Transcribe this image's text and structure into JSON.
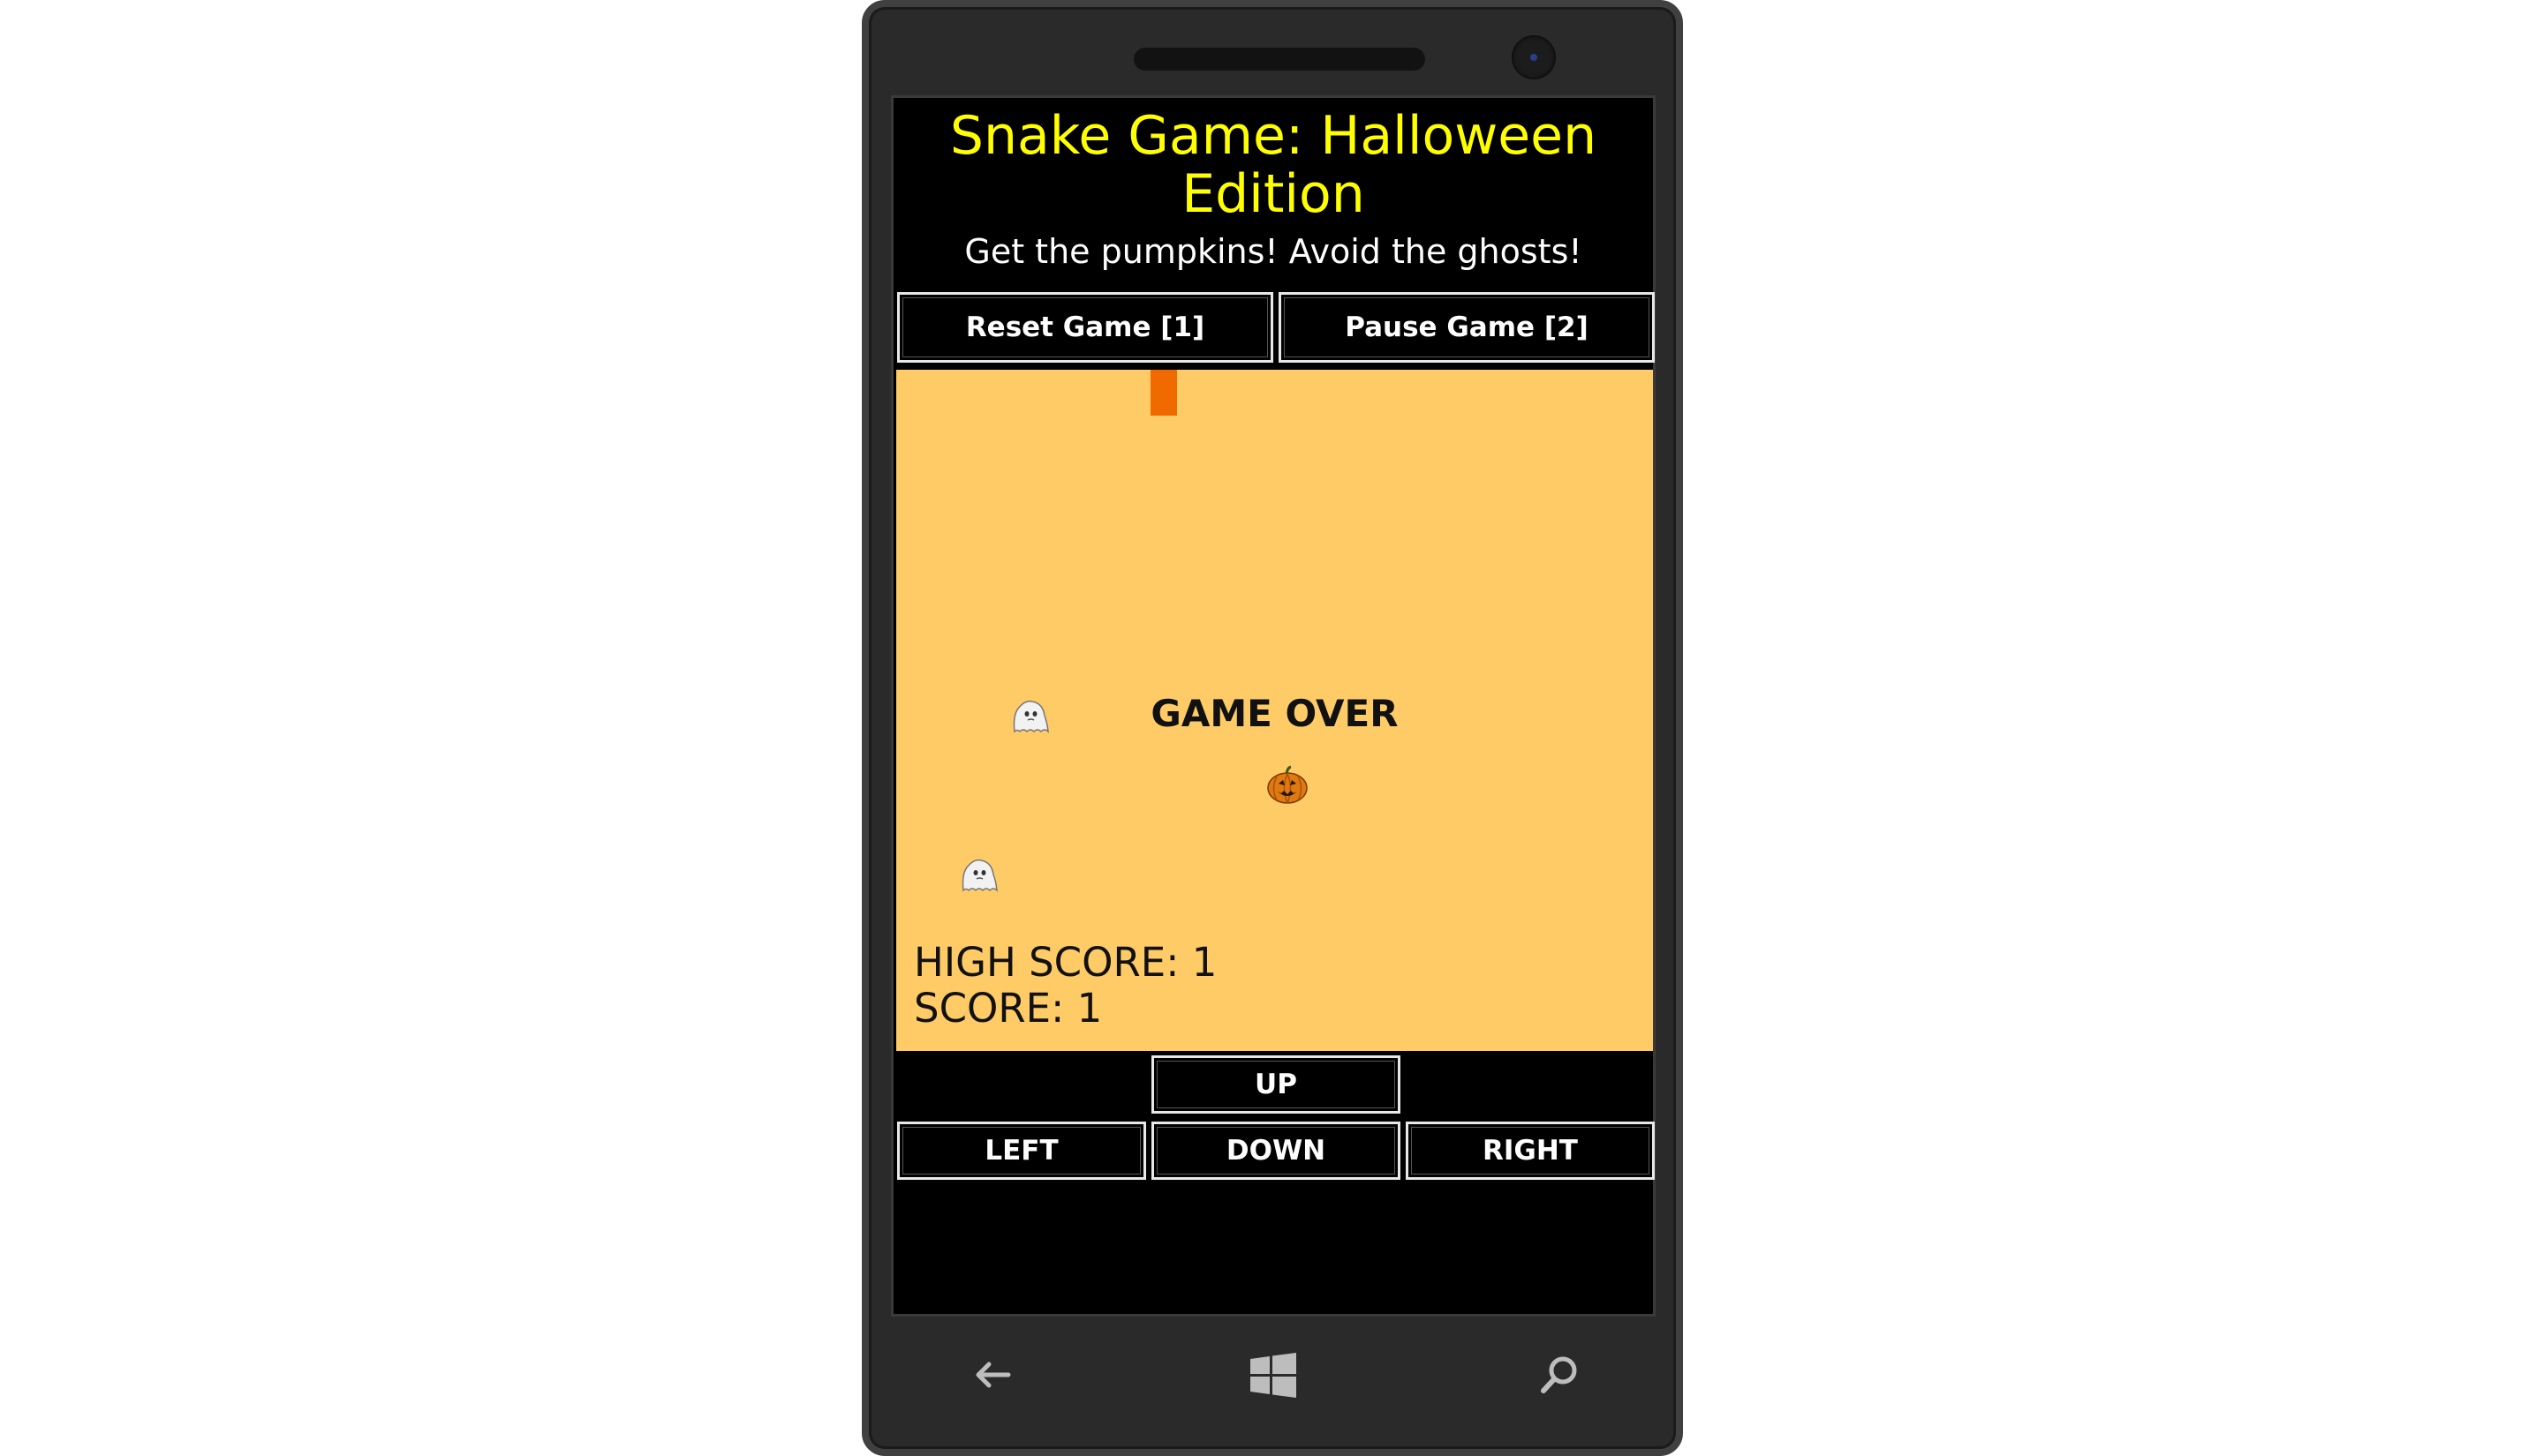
{
  "header": {
    "title": "Snake Game: Halloween Edition",
    "subtitle": "Get the pumpkins! Avoid the ghosts!"
  },
  "controls": {
    "reset_label": "Reset Game [1]",
    "pause_label": "Pause Game [2]"
  },
  "board": {
    "status": "GAME OVER",
    "high_score": "HIGH SCORE: 1",
    "score": "SCORE: 1",
    "colors": {
      "background": "#fecb67",
      "snake": "#f06a00"
    }
  },
  "dpad": {
    "up": "UP",
    "left": "LEFT",
    "down": "DOWN",
    "right": "RIGHT"
  },
  "hardware_buttons": {
    "back_icon": "back-arrow-icon",
    "start_icon": "windows-logo-icon",
    "search_icon": "search-icon"
  }
}
